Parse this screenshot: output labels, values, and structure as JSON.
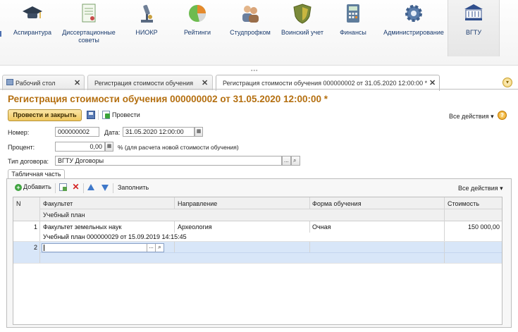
{
  "sections": [
    {
      "label": "Аспирантура",
      "icon": "graduation-cap-icon"
    },
    {
      "label": "Диссертационные советы",
      "icon": "document-icon"
    },
    {
      "label": "НИОКР",
      "icon": "microscope-icon"
    },
    {
      "label": "Рейтинги",
      "icon": "pie-chart-icon"
    },
    {
      "label": "Студпрофком",
      "icon": "people-icon"
    },
    {
      "label": "Воинский учет",
      "icon": "shield-icon"
    },
    {
      "label": "Финансы",
      "icon": "calculator-icon"
    },
    {
      "label": "Администрирование",
      "icon": "gear-icon"
    },
    {
      "label": "ВГТУ",
      "icon": "university-logo-icon"
    }
  ],
  "tabs": [
    {
      "label": "Рабочий стол",
      "close": "✕"
    },
    {
      "label": "Регистрация стоимости обучения",
      "close": "✕"
    },
    {
      "label": "Регистрация стоимости обучения 000000002 от 31.05.2020 12:00:00 *",
      "close": "✕"
    }
  ],
  "grip": "▪▪▪",
  "document": {
    "title": "Регистрация стоимости обучения 000000002 от 31.05.2020 12:00:00 *",
    "post_and_close": "Провести и закрыть",
    "post": "Провести",
    "all_actions": "Все действия ▾",
    "help": "?"
  },
  "form": {
    "number_label": "Номер:",
    "number_value": "000000002",
    "date_label": "Дата:",
    "date_value": "31.05.2020 12:00:00",
    "percent_label": "Процент:",
    "percent_value": "0,00",
    "percent_hint": "% (для расчета новой стоимости обучения)",
    "contract_type_label": "Тип договора:",
    "contract_type_value": "ВГТУ Договоры",
    "select_btn": "...",
    "search_btn": "🔍"
  },
  "table_part": {
    "tab_label": "Табличная часть",
    "toolbar": {
      "add": "Добавить",
      "fill": "Заполнить",
      "all_actions": "Все действия ▾"
    },
    "columns": {
      "n": "N",
      "faculty": "Факультет",
      "curriculum": "Учебный план",
      "direction": "Направление",
      "study_form": "Форма обучения",
      "cost": "Стоимость"
    },
    "rows": [
      {
        "n": "1",
        "faculty": "Факультет земельных наук",
        "curriculum": "Учебный план 000000029 от 15.09.2019 14:15:45",
        "direction": "Археология",
        "study_form": "Очная",
        "cost": "150 000,00"
      },
      {
        "n": "2",
        "faculty": "",
        "curriculum": "",
        "direction": "",
        "study_form": "",
        "cost": ""
      }
    ]
  },
  "colors": {
    "title": "#b46f10",
    "link": "#1a3b6e",
    "selected_row": "#d8e6f8"
  }
}
